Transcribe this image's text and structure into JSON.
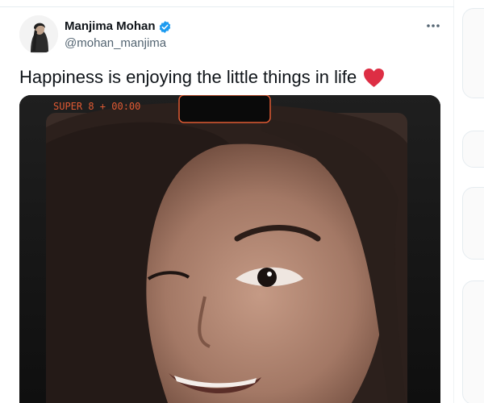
{
  "tweet": {
    "display_name": "Manjima Mohan",
    "handle": "@mohan_manjima",
    "text": "Happiness is enjoying the little things in life",
    "emoji": "red-heart",
    "verified": true
  },
  "media": {
    "overlay_text": "SUPER 8 + 00:00"
  },
  "icons": {
    "verified": "verified-badge-icon",
    "more": "more-options-icon",
    "heart": "red-heart-icon"
  },
  "colors": {
    "name": "#0f1419",
    "handle": "#536471",
    "verified_blue": "#1d9bf0",
    "heart_red": "#e0245e",
    "overlay_orange": "#e05a33"
  }
}
